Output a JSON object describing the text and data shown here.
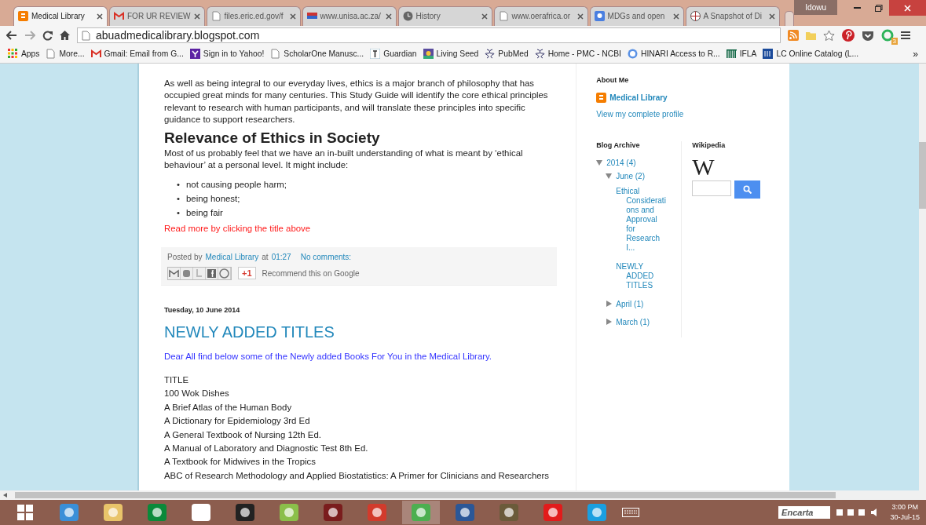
{
  "browser": {
    "tabs": [
      {
        "title": "Medical Library",
        "kind": "blogger",
        "selected": true
      },
      {
        "title": "FOR UR REVIEW",
        "kind": "gmail",
        "selected": false
      },
      {
        "title": "files.eric.ed.gov/f",
        "kind": "doc",
        "selected": false
      },
      {
        "title": "www.unisa.ac.za/",
        "kind": "flag",
        "selected": false
      },
      {
        "title": "History",
        "kind": "history",
        "selected": false
      },
      {
        "title": "www.oerafrica.or",
        "kind": "doc",
        "selected": false
      },
      {
        "title": "MDGs and open",
        "kind": "maps",
        "selected": false
      },
      {
        "title": "A Snapshot of Di",
        "kind": "globe",
        "selected": false
      }
    ],
    "profile": "Idowu",
    "address": "abuadmedicalibrary.blogspot.com",
    "extension_badge": "3",
    "bookmarks": [
      {
        "label": "Apps",
        "kind": "apps"
      },
      {
        "label": "More...",
        "kind": "doc"
      },
      {
        "label": "Gmail: Email from G...",
        "kind": "gmail"
      },
      {
        "label": "Sign in to Yahoo!",
        "kind": "yahoo"
      },
      {
        "label": "ScholarOne Manusc...",
        "kind": "doc"
      },
      {
        "label": "Guardian",
        "kind": "guardian"
      },
      {
        "label": "Living Seed",
        "kind": "seed"
      },
      {
        "label": "PubMed",
        "kind": "ncbi"
      },
      {
        "label": "Home - PMC - NCBI",
        "kind": "ncbi"
      },
      {
        "label": "HINARI Access to R...",
        "kind": "who"
      },
      {
        "label": "IFLA",
        "kind": "ifla"
      },
      {
        "label": "LC Online Catalog (L...",
        "kind": "lc"
      }
    ],
    "bookmarks_more": "»"
  },
  "post1": {
    "paragraph": "As well as being integral to our everyday lives, ethics is a major branch of philosophy that has occupied great minds for many centuries. This Study Guide will identify the core ethical principles relevant to research with human participants, and will translate these principles into specific guidance to support researchers.",
    "heading": "Relevance of Ethics in Society",
    "intro": "Most of us probably feel that we have an in-built understanding of what is meant by ‘ethical behaviour’ at a personal level. It might include:",
    "bullet_marker": "•",
    "bullets": [
      "not causing people harm;",
      "being honest;",
      "being fair"
    ],
    "read_more": "Read more by clicking the title above",
    "footer": {
      "posted_by": "Posted by",
      "author": "Medical Library",
      "at": "at",
      "time": "01:27",
      "comments": "No comments:",
      "plus_one": "+1",
      "recommend": "Recommend this on Google"
    }
  },
  "post2": {
    "date": "Tuesday, 10 June 2014",
    "title": "NEWLY ADDED TITLES",
    "intro": "Dear All find below some of the Newly added Books For You in the Medical Library.",
    "lines": [
      "TITLE",
      "100 Wok Dishes",
      "A Brief Atlas of the Human Body",
      "A Dictionary for Epidemiology 3rd Ed",
      "A General Textbook of Nursing 12th Ed.",
      "A Manual of Laboratory and Diagnostic Test 8th Ed.",
      "A Textbook for Midwives in the Tropics",
      "ABC of Research Methodology and Applied Biostatistics: A Primer for Clinicians and Researchers"
    ]
  },
  "sidebar": {
    "about_title": "About Me",
    "profile_name": "Medical Library",
    "view_profile": "View my complete profile",
    "archive_title": "Blog Archive",
    "archive": [
      {
        "label": "2014 (4)",
        "expanded": true,
        "children": [
          {
            "label": "June (2)",
            "expanded": true,
            "children": [
              {
                "label": "Ethical Considerations and Approval for Research I..."
              },
              {
                "label": "NEWLY ADDED TITLES"
              }
            ]
          },
          {
            "label": "April (1)",
            "expanded": false
          },
          {
            "label": "March (1)",
            "expanded": false
          }
        ]
      }
    ],
    "wikipedia_title": "Wikipedia",
    "wikipedia_logo": "W"
  },
  "taskbar": {
    "search_label": "Encarta",
    "time": "3:00 PM",
    "date": "30-Jul-15"
  }
}
